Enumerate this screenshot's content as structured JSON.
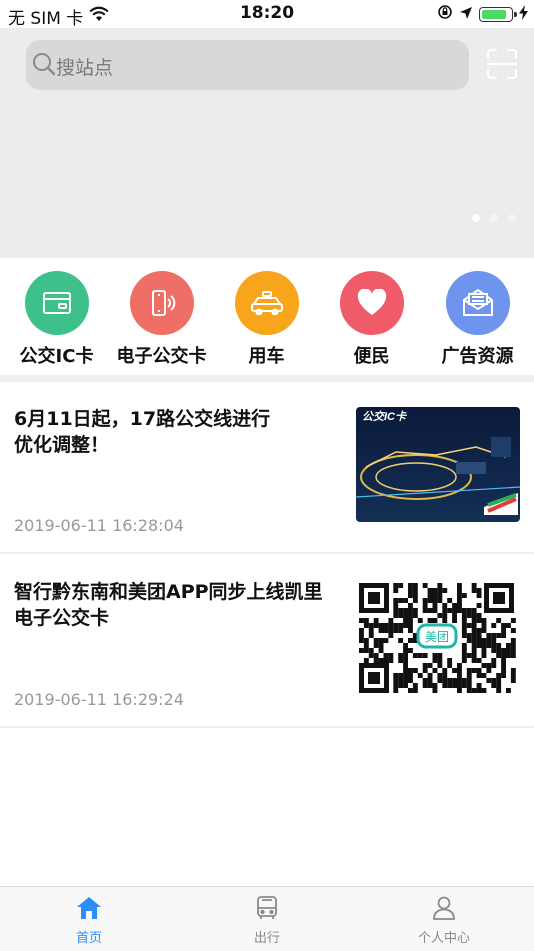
{
  "status": {
    "carrier": "无 SIM 卡",
    "time": "18:20"
  },
  "search": {
    "placeholder": "搜站点"
  },
  "menu": [
    {
      "label": "公交IC卡",
      "icon": "card-icon",
      "color": "#3ec08b"
    },
    {
      "label": "电子公交卡",
      "icon": "phone-nfc-icon",
      "color": "#ef6f66"
    },
    {
      "label": "用车",
      "icon": "taxi-icon",
      "color": "#f8a51b"
    },
    {
      "label": "便民",
      "icon": "heart-icon",
      "color": "#ef5b69"
    },
    {
      "label": "广告资源",
      "icon": "mail-icon",
      "color": "#6f94ed"
    }
  ],
  "news": [
    {
      "title_line1": "6月11日起，17路公交线进行",
      "title_line2": "优化调整！",
      "date": "2019-06-11 16:28:04",
      "thumb_label": "公交IC卡"
    },
    {
      "title_line1": "智行黔东南和美团APP同步上线凯里",
      "title_line2": "电子公交卡",
      "date": "2019-06-11 16:29:24",
      "thumb_label": "美团"
    }
  ],
  "tabs": [
    {
      "label": "首页",
      "icon": "home-icon",
      "active": true
    },
    {
      "label": "出行",
      "icon": "bus-icon",
      "active": false
    },
    {
      "label": "个人中心",
      "icon": "user-icon",
      "active": false
    }
  ],
  "colors": {
    "accent": "#2b8ef4"
  }
}
